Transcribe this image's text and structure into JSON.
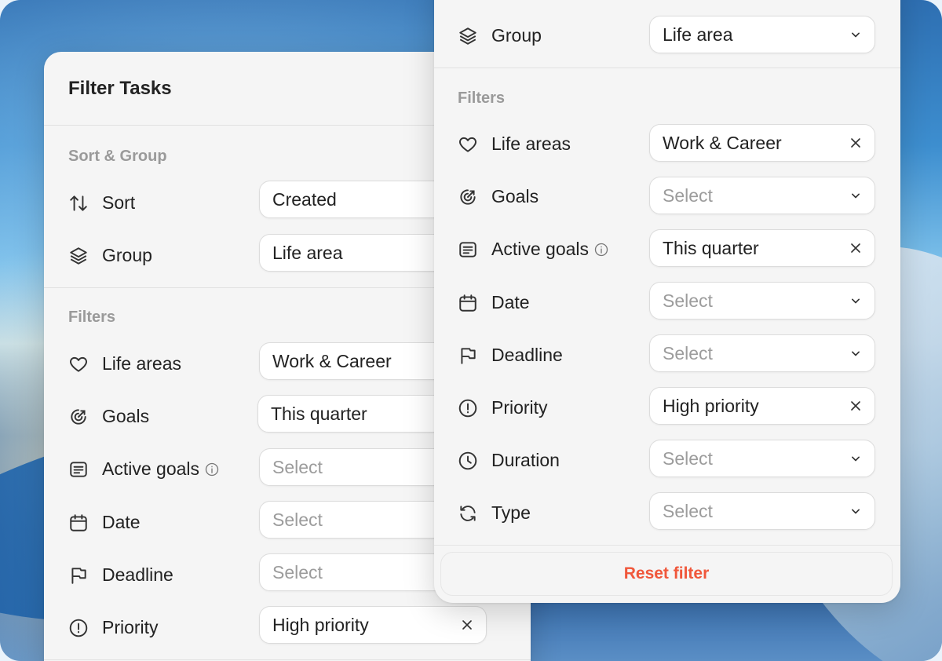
{
  "back_panel": {
    "title": "Filter Tasks",
    "sort_group_header": "Sort & Group",
    "filters_header": "Filters",
    "rows": [
      {
        "label": "Sort",
        "icon": "sort-arrows-icon",
        "value": "Created",
        "placeholder": false
      },
      {
        "label": "Group",
        "icon": "layers-icon",
        "value": "Life area",
        "placeholder": false
      },
      {
        "label": "Life areas",
        "icon": "heart-icon",
        "value": "Work & Career",
        "placeholder": false
      },
      {
        "label": "Goals",
        "icon": "target-icon",
        "value": "This quarter",
        "placeholder": false
      },
      {
        "label": "Active goals",
        "icon": "list-box-icon",
        "value": "Select",
        "placeholder": true
      },
      {
        "label": "Date",
        "icon": "calendar-icon",
        "value": "Select",
        "placeholder": true
      },
      {
        "label": "Deadline",
        "icon": "flag-icon",
        "value": "Select",
        "placeholder": true
      },
      {
        "label": "Priority",
        "icon": "exclamation-circle-icon",
        "value": "High priority",
        "placeholder": false
      }
    ]
  },
  "front_panel": {
    "filters_header": "Filters",
    "rows": [
      {
        "label": "Group",
        "icon": "layers-icon",
        "value": "Life area",
        "control": "chevron"
      },
      {
        "label": "Life areas",
        "icon": "heart-icon",
        "value": "Work & Career",
        "control": "clear"
      },
      {
        "label": "Goals",
        "icon": "target-icon",
        "value": "Select",
        "control": "chevron"
      },
      {
        "label": "Active goals",
        "icon": "list-box-icon",
        "value": "This quarter",
        "control": "clear"
      },
      {
        "label": "Date",
        "icon": "calendar-icon",
        "value": "Select",
        "control": "chevron"
      },
      {
        "label": "Deadline",
        "icon": "flag-icon",
        "value": "Select",
        "control": "chevron"
      },
      {
        "label": "Priority",
        "icon": "exclamation-circle-icon",
        "value": "High priority",
        "control": "clear"
      },
      {
        "label": "Duration",
        "icon": "clock-icon",
        "value": "Select",
        "control": "chevron"
      },
      {
        "label": "Type",
        "icon": "refresh-icon",
        "value": "Select",
        "control": "chevron"
      }
    ],
    "reset_label": "Reset filter"
  },
  "colors": {
    "accent_reset": "#f0573b",
    "placeholder": "#9c9c9c",
    "section_header": "#9a9a9a"
  }
}
